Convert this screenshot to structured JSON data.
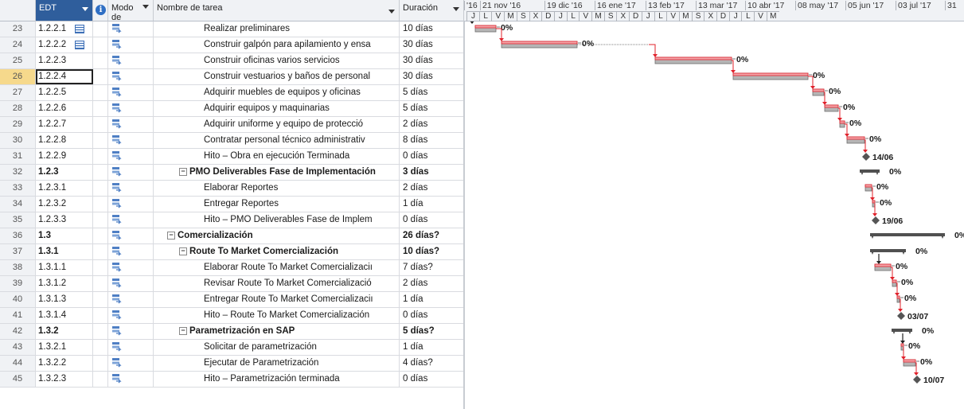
{
  "columns": {
    "edt": "EDT",
    "info_icon": "information-icon",
    "modo": "Modo de",
    "name": "Nombre de tarea",
    "duration": "Duración"
  },
  "timescale": {
    "top": [
      "'16",
      "21 nov '16",
      "19 dic '16",
      "16 ene '17",
      "13 feb '17",
      "13 mar '17",
      "10 abr '17",
      "08 may '17",
      "05 jun '17",
      "03 jul '17",
      "31"
    ],
    "bottom": [
      "J",
      "L",
      "V",
      "M",
      "S",
      "X",
      "D",
      "J",
      "L",
      "V",
      "M",
      "S",
      "X",
      "D",
      "J",
      "L",
      "V",
      "M",
      "S",
      "X",
      "D",
      "J",
      "L",
      "V",
      "M"
    ]
  },
  "rows": [
    {
      "num": "23",
      "edt": "1.2.2.1",
      "icon": "table-icon",
      "name": "Realizar preliminares",
      "dur": "10 días",
      "level": 3,
      "bold": false,
      "summary": false
    },
    {
      "num": "24",
      "edt": "1.2.2.2",
      "icon": "table-icon",
      "name": "Construir galpón para apilamiento y ensa",
      "dur": "30 días",
      "level": 3,
      "bold": false,
      "summary": false
    },
    {
      "num": "25",
      "edt": "1.2.2.3",
      "icon": "",
      "name": "Construir oficinas varios servicios",
      "dur": "30 días",
      "level": 3,
      "bold": false,
      "summary": false
    },
    {
      "num": "26",
      "edt": "1.2.2.4",
      "icon": "",
      "name": "Construir vestuarios y baños de personal",
      "dur": "30 días",
      "level": 3,
      "bold": false,
      "summary": false,
      "selected": true
    },
    {
      "num": "27",
      "edt": "1.2.2.5",
      "icon": "",
      "name": "Adquirir muebles de equipos y oficinas",
      "dur": "5 días",
      "level": 3,
      "bold": false,
      "summary": false
    },
    {
      "num": "28",
      "edt": "1.2.2.6",
      "icon": "",
      "name": "Adquirir equipos y maquinarias",
      "dur": "5 días",
      "level": 3,
      "bold": false,
      "summary": false
    },
    {
      "num": "29",
      "edt": "1.2.2.7",
      "icon": "",
      "name": "Adquirir uniforme y equipo de protecció",
      "dur": "2 días",
      "level": 3,
      "bold": false,
      "summary": false
    },
    {
      "num": "30",
      "edt": "1.2.2.8",
      "icon": "",
      "name": "Contratar  personal técnico administrativ",
      "dur": "8 días",
      "level": 3,
      "bold": false,
      "summary": false
    },
    {
      "num": "31",
      "edt": "1.2.2.9",
      "icon": "",
      "name": "Hito – Obra en ejecución Terminada",
      "dur": "0 días",
      "level": 3,
      "bold": false,
      "summary": false
    },
    {
      "num": "32",
      "edt": "1.2.3",
      "icon": "",
      "name": "PMO Deliverables Fase de Implementación",
      "dur": "3 días",
      "level": 2,
      "bold": true,
      "summary": true
    },
    {
      "num": "33",
      "edt": "1.2.3.1",
      "icon": "",
      "name": "Elaborar  Reportes",
      "dur": "2 días",
      "level": 3,
      "bold": false,
      "summary": false
    },
    {
      "num": "34",
      "edt": "1.2.3.2",
      "icon": "",
      "name": "Entregar  Reportes",
      "dur": "1 día",
      "level": 3,
      "bold": false,
      "summary": false
    },
    {
      "num": "35",
      "edt": "1.2.3.3",
      "icon": "",
      "name": "Hito – PMO Deliverables Fase de Implem",
      "dur": "0 días",
      "level": 3,
      "bold": false,
      "summary": false
    },
    {
      "num": "36",
      "edt": "1.3",
      "icon": "",
      "name": "Comercialización",
      "dur": "26 días?",
      "level": 1,
      "bold": true,
      "summary": true
    },
    {
      "num": "37",
      "edt": "1.3.1",
      "icon": "",
      "name": "Route To Market Comercialización",
      "dur": "10 días?",
      "level": 2,
      "bold": true,
      "summary": true
    },
    {
      "num": "38",
      "edt": "1.3.1.1",
      "icon": "",
      "name": "Elaborar Route To Market Comercializaciı",
      "dur": "7 días?",
      "level": 3,
      "bold": false,
      "summary": false
    },
    {
      "num": "39",
      "edt": "1.3.1.2",
      "icon": "",
      "name": "Revisar Route To Market Comercializació",
      "dur": "2 días",
      "level": 3,
      "bold": false,
      "summary": false
    },
    {
      "num": "40",
      "edt": "1.3.1.3",
      "icon": "",
      "name": "Entregar Route To Market Comercializaciı",
      "dur": "1 día",
      "level": 3,
      "bold": false,
      "summary": false
    },
    {
      "num": "41",
      "edt": "1.3.1.4",
      "icon": "",
      "name": "Hito – Route To Market Comercialización",
      "dur": "0 días",
      "level": 3,
      "bold": false,
      "summary": false
    },
    {
      "num": "42",
      "edt": "1.3.2",
      "icon": "",
      "name": "Parametrización en SAP",
      "dur": "5 días?",
      "level": 2,
      "bold": true,
      "summary": true
    },
    {
      "num": "43",
      "edt": "1.3.2.1",
      "icon": "",
      "name": "Solicitar de parametrización",
      "dur": "1 día",
      "level": 3,
      "bold": false,
      "summary": false
    },
    {
      "num": "44",
      "edt": "1.3.2.2",
      "icon": "",
      "name": "Ejecutar de Parametrización",
      "dur": "4 días?",
      "level": 3,
      "bold": false,
      "summary": false
    },
    {
      "num": "45",
      "edt": "1.3.2.3",
      "icon": "",
      "name": "Hito – Parametrización terminada",
      "dur": "0 días",
      "level": 3,
      "bold": false,
      "summary": false
    }
  ],
  "gantt_labels": {
    "r23": "0%",
    "r24": "0%",
    "r25": "0%",
    "r26": "0%",
    "r27": "0%",
    "r28": "0%",
    "r29": "0%",
    "r30": "0%",
    "r31": "14/06",
    "r32": "0%",
    "r33": "0%",
    "r34": "0%",
    "r35": "19/06",
    "r36": "0%",
    "r37": "0%",
    "r38": "0%",
    "r39": "0%",
    "r40": "0%",
    "r41": "03/07",
    "r42": "0%",
    "r43": "0%",
    "r44": "0%",
    "r45": "10/07"
  },
  "colors": {
    "task_bar": "#a0a0a0",
    "critical": "#e0202a",
    "summary": "#505050",
    "selected_row": "#f6d98c",
    "header_edt": "#2f5e9c"
  }
}
